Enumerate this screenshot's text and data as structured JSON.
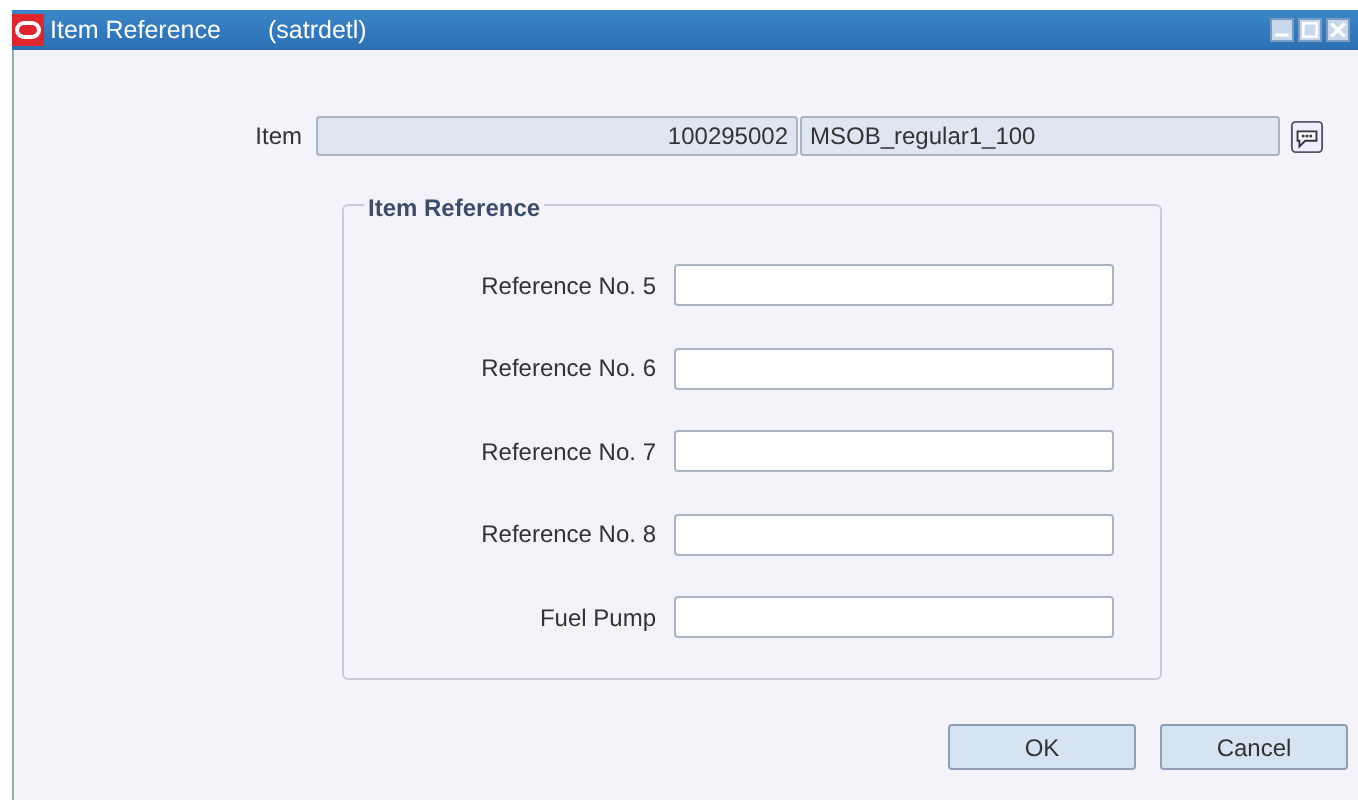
{
  "window": {
    "title": "Item Reference",
    "subtitle": "(satrdetl)"
  },
  "item": {
    "label": "Item",
    "number": "100295002",
    "description": "MSOB_regular1_100"
  },
  "group": {
    "title": "Item Reference",
    "fields": [
      {
        "label": "Reference No. 5"
      },
      {
        "label": "Reference No. 6"
      },
      {
        "label": "Reference No. 7"
      },
      {
        "label": "Reference No. 8"
      },
      {
        "label": "Fuel Pump"
      }
    ]
  },
  "buttons": [
    "OK",
    "Cancel"
  ]
}
